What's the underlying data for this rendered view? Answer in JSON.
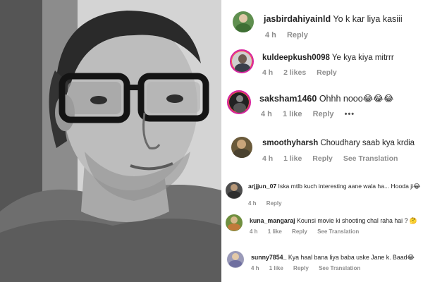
{
  "comments": [
    {
      "username": "jasbirdahiyainld",
      "text": "Yo k kar liya kasiii",
      "time": "4 h",
      "likes": "",
      "reply": "Reply",
      "translate": "",
      "more": "",
      "avatar_icon": "user-avatar-icon"
    },
    {
      "username": "kuldeepkush0098",
      "text": "Ye kya kiya mitrrr",
      "time": "4 h",
      "likes": "2 likes",
      "reply": "Reply",
      "translate": "",
      "more": "",
      "avatar_icon": "user-avatar-icon"
    },
    {
      "username": "saksham1460",
      "text": "Ohhh nooo😂😂😂",
      "time": "4 h",
      "likes": "1 like",
      "reply": "Reply",
      "translate": "",
      "more": "•••",
      "avatar_icon": "user-avatar-icon"
    },
    {
      "username": "smoothyharsh",
      "text": "Choudhary saab kya krdia",
      "time": "4 h",
      "likes": "1 like",
      "reply": "Reply",
      "translate": "See Translation",
      "more": "",
      "avatar_icon": "user-avatar-icon"
    },
    {
      "username": "arjjjun_07",
      "text": "Iska mtlb kuch interesting aane wala ha... Hooda ji😂",
      "time": "4 h",
      "likes": "",
      "reply": "Reply",
      "translate": "",
      "more": "",
      "avatar_icon": "user-avatar-icon"
    },
    {
      "username": "kuna_mangaraj",
      "text": "Kounsi movie ki shooting chal raha hai ? 🤔",
      "time": "4 h",
      "likes": "1 like",
      "reply": "Reply",
      "translate": "See Translation",
      "more": "",
      "avatar_icon": "user-avatar-icon"
    },
    {
      "username": "sunny7854_",
      "text": "Kya haal bana liya baba uske Jane k. Baad😂",
      "time": "4 h",
      "likes": "1 like",
      "reply": "Reply",
      "translate": "See Translation",
      "more": "",
      "avatar_icon": "user-avatar-icon"
    }
  ]
}
